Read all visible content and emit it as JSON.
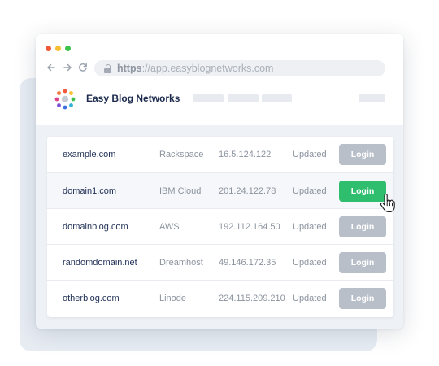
{
  "browser": {
    "url_scheme": "https",
    "url_separator": "://",
    "url_host": "app.easyblognetworks.com"
  },
  "brand": {
    "name": "Easy Blog Networks"
  },
  "colors": {
    "login_active": "#2fbd6e",
    "login_inactive": "#b9bfc9",
    "domain_text": "#1f2f55"
  },
  "sites": [
    {
      "domain": "example.com",
      "host": "Rackspace",
      "ip": "16.5.124.122",
      "status": "Updated",
      "action": "Login",
      "active": false
    },
    {
      "domain": "domain1.com",
      "host": "IBM Cloud",
      "ip": "201.24.122.78",
      "status": "Updated",
      "action": "Login",
      "active": true
    },
    {
      "domain": "domainblog.com",
      "host": "AWS",
      "ip": "192.112.164.50",
      "status": "Updated",
      "action": "Login",
      "active": false
    },
    {
      "domain": "randomdomain.net",
      "host": "Dreamhost",
      "ip": "49.146.172.35",
      "status": "Updated",
      "action": "Login",
      "active": false
    },
    {
      "domain": "otherblog.com",
      "host": "Linode",
      "ip": "224.115.209.210",
      "status": "Updated",
      "action": "Login",
      "active": false
    }
  ],
  "icons": {
    "back": "arrow-left-icon",
    "forward": "arrow-right-icon",
    "reload": "reload-icon",
    "lock": "lock-icon",
    "cursor": "hand-pointer-icon"
  }
}
